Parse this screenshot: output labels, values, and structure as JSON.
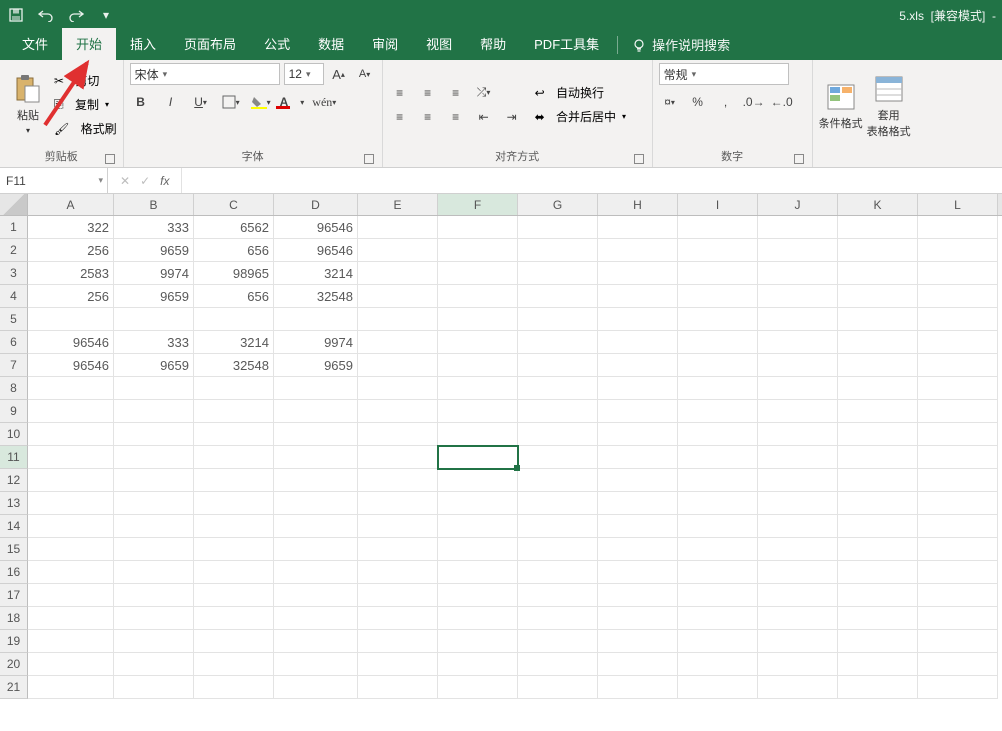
{
  "titlebar": {
    "doc_name": "5.xls",
    "mode": "[兼容模式]",
    "suffix": "-"
  },
  "tabs": {
    "file": "文件",
    "home": "开始",
    "insert": "插入",
    "layout": "页面布局",
    "formulas": "公式",
    "data": "数据",
    "review": "审阅",
    "view": "视图",
    "help": "帮助",
    "pdf": "PDF工具集",
    "tell": "操作说明搜索"
  },
  "ribbon": {
    "paste": "粘贴",
    "cut": "剪切",
    "copy": "复制",
    "format_painter": "格式刷",
    "clipboard_group": "剪贴板",
    "font_name": "宋体",
    "font_size": "12",
    "font_group": "字体",
    "wrap": "自动换行",
    "merge": "合并后居中",
    "align_group": "对齐方式",
    "number_format": "常规",
    "number_group": "数字",
    "cond_fmt": "条件格式",
    "table_fmt": "套用\n表格格式"
  },
  "formula_bar": {
    "name_box": "F11",
    "formula": ""
  },
  "columns": [
    "A",
    "B",
    "C",
    "D",
    "E",
    "F",
    "G",
    "H",
    "I",
    "J",
    "K",
    "L"
  ],
  "selected": {
    "col": "F",
    "row": 11
  },
  "chart_data": {
    "type": "table",
    "columns": [
      "A",
      "B",
      "C",
      "D"
    ],
    "rows": [
      {
        "r": 1,
        "A": 322,
        "B": 333,
        "C": 6562,
        "D": 96546
      },
      {
        "r": 2,
        "A": 256,
        "B": 9659,
        "C": 656,
        "D": 96546
      },
      {
        "r": 3,
        "A": 2583,
        "B": 9974,
        "C": 98965,
        "D": 3214
      },
      {
        "r": 4,
        "A": 256,
        "B": 9659,
        "C": 656,
        "D": 32548
      },
      {
        "r": 5
      },
      {
        "r": 6,
        "A": 96546,
        "B": 333,
        "C": 3214,
        "D": 9974
      },
      {
        "r": 7,
        "A": 96546,
        "B": 9659,
        "C": 32548,
        "D": 9659
      }
    ]
  },
  "row_count": 21
}
